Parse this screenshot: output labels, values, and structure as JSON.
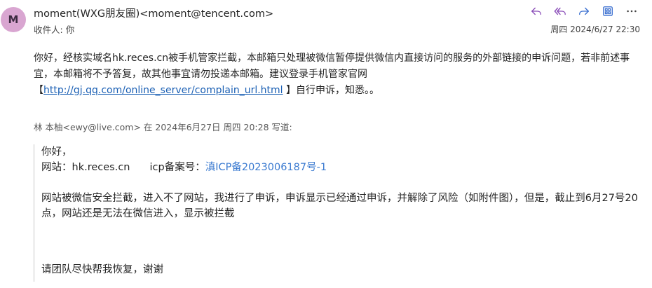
{
  "header": {
    "avatar_letter": "M",
    "sender": "moment(WXG朋友圈)<moment@tencent.com>",
    "recipient_label": "收件人:",
    "recipient": "你",
    "date": "周四 2024/6/27 22:30",
    "actions": [
      {
        "name": "reply-icon"
      },
      {
        "name": "reply-all-icon"
      },
      {
        "name": "forward-icon"
      },
      {
        "name": "apps-icon"
      },
      {
        "name": "more-icon"
      }
    ],
    "accent_color": "#8a4db8"
  },
  "body": {
    "paragraph1": "你好，经核实域名hk.reces.cn被手机管家拦截，本邮箱只处理被微信暂停提供微信内直接访问的服务的外部链接的申诉问题，若非前述事宜，本邮箱将不予答复，故其他事宜请勿投递本邮箱。建议登录手机管家官网",
    "link_open": "【",
    "link": "http://gj.qq.com/online_server/complain_url.html",
    "link_close": " 】自行申诉，知悉。。"
  },
  "quote": {
    "header": "林 本柚<ewy@live.com> 在 2024年6月27日 周四 20:28 写道:",
    "greeting": "你好，",
    "site_label": "网站：",
    "site_value": "hk.reces.cn",
    "icp_label": "icp备案号：",
    "icp_value": "滇ICP备2023006187号-1",
    "paragraph": "网站被微信安全拦截，进入不了网站，我进行了申诉，申诉显示已经通过申诉，并解除了风险（如附件图），但是，截止到6月27号20点，网站还是无法在微信进入，显示被拦截",
    "closing": "请团队尽快帮我恢复，谢谢"
  }
}
